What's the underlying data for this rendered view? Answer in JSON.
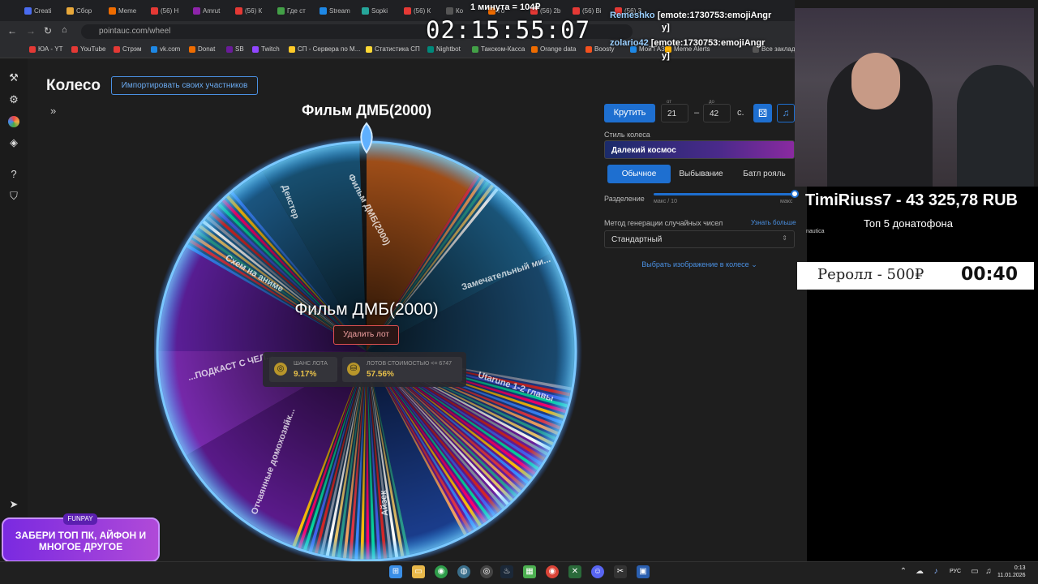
{
  "browser": {
    "tabs": [
      "Creati",
      "Сбор",
      "Meme",
      "(56) Н",
      "Amrut",
      "(56) К",
      "Где ст",
      "Stream",
      "Sopki",
      "(56) К",
      "Ко",
      "Го",
      "(56) 2b",
      "(56) Bi",
      "(56) 3"
    ],
    "url": "pointauc.com/wheel",
    "bookmarks": [
      "ЮА - YT",
      "YouTube",
      "Стрэм",
      "vk.com",
      "Donat",
      "SB",
      "Twitch",
      "СП - Сервера по M...",
      "Статистика СП",
      "Nightbot",
      "Такском-Касса",
      "Orange data",
      "Boosty",
      "Мой ГАЗ",
      "Meme Alerts",
      "Все закладки"
    ]
  },
  "sidebar": {
    "icons": [
      "gavel-icon",
      "gear-icon",
      "wheel-icon",
      "layers-icon",
      "help-icon",
      "shield-icon",
      "telegram-icon"
    ]
  },
  "header": {
    "title": "Колесо",
    "import_label": "Импортировать своих участников"
  },
  "wheel": {
    "top_title": "Фильм ДМБ(2000)",
    "center_name": "Фильм ДМБ(2000)",
    "delete_label": "Удалить лот",
    "slice_labels": [
      "Фильм ДМБ(2000)",
      "Декстер",
      "Схем на аниме",
      "...ПОДКАСТ С ЧЕЛ...",
      "Отчаянные домохозяйк...",
      "Айзек",
      "Utarune 1-2 главы",
      "Замечательный ми..."
    ],
    "chance_label": "ШАНС ЛОТА",
    "chance_value": "9.17%",
    "cost_label": "ЛОТОВ СТОИМОСТЬЮ <= 6747",
    "cost_value": "57.56%"
  },
  "controls": {
    "spin_label": "Крутить",
    "from_label": "от",
    "from_value": "21",
    "to_label": "до",
    "to_value": "42",
    "dash": "–",
    "seconds": "с.",
    "style_label": "Стиль колеса",
    "style_value": "Далекий космос",
    "modes": [
      "Обычное",
      "Выбывание",
      "Батл рояль"
    ],
    "split_label": "Разделение",
    "split_min": "макс / 10",
    "split_max": "макс",
    "split_level": 1.0,
    "method_label": "Метод генерации случайных чисел",
    "method_more": "Узнать больше",
    "method_value": "Стандартный",
    "choose_image": "Выбрать изображение в колесе"
  },
  "overlay": {
    "timer": "02:15:55:07",
    "minute": "1 минута = 104₽",
    "chat": [
      {
        "user": "Remeshko",
        "text": "[emote:1730753:emojiAngr"
      },
      {
        "user": "",
        "text": "y]"
      },
      {
        "user": "zolario42",
        "text": "[emote:1730753:emojiAngr"
      },
      {
        "user": "",
        "text": "y]"
      }
    ],
    "donor": "TimiRiuss7 - 43 325,78 RUB",
    "top5": "Топ  5 донатофона",
    "nautica": "nautica",
    "reroll_label": "Реролл - 500₽",
    "reroll_time": "00:40",
    "promo_brand": "FUNPAY",
    "promo_text": "ЗАБЕРИ ТОП ПК, АЙФОН И МНОГОЕ ДРУГОЕ"
  },
  "taskbar": {
    "lang": "РУС",
    "time": "0:13",
    "date": "11.01.2026"
  }
}
